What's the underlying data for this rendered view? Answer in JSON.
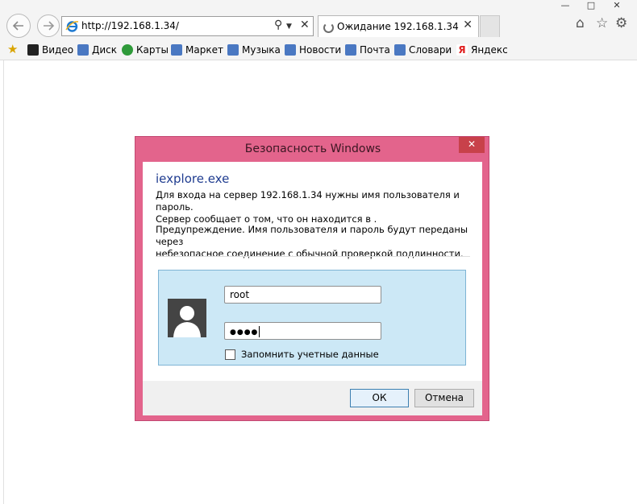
{
  "browser": {
    "address_url": "http://192.168.1.34/",
    "tab_title": "Ожидание 192.168.1.34",
    "favorites": [
      {
        "label": "Видео",
        "icon": "video-icon",
        "color": "#222222"
      },
      {
        "label": "Диск",
        "icon": "disk-icon",
        "color": "#4a78c2"
      },
      {
        "label": "Карты",
        "icon": "maps-icon",
        "color": "#2f9a3a"
      },
      {
        "label": "Маркет",
        "icon": "market-icon",
        "color": "#4a78c2"
      },
      {
        "label": "Музыка",
        "icon": "music-icon",
        "color": "#4a78c2"
      },
      {
        "label": "Новости",
        "icon": "news-icon",
        "color": "#4a78c2"
      },
      {
        "label": "Почта",
        "icon": "mail-icon",
        "color": "#4a78c2"
      },
      {
        "label": "Словари",
        "icon": "dictionary-icon",
        "color": "#4a78c2"
      },
      {
        "label": "Яндекс",
        "icon": "yandex-icon",
        "color": "#e02020"
      }
    ]
  },
  "dialog": {
    "title": "Безопасность Windows",
    "app_name": "iexplore.exe",
    "message_line1": "Для входа на сервер 192.168.1.34 нужны имя пользователя и пароль.",
    "message_line2": "Сервер сообщает о том, что он находится в .",
    "warning_line1": "Предупреждение. Имя пользователя и пароль будут переданы через",
    "warning_line2": "небезопасное соединение с обычной проверкой подлинности.",
    "username_value": "root",
    "password_mask": "●●●●",
    "remember_label": "Запомнить учетные данные",
    "ok_label": "ОК",
    "cancel_label": "Отмена",
    "accent_color": "#e3648c"
  }
}
